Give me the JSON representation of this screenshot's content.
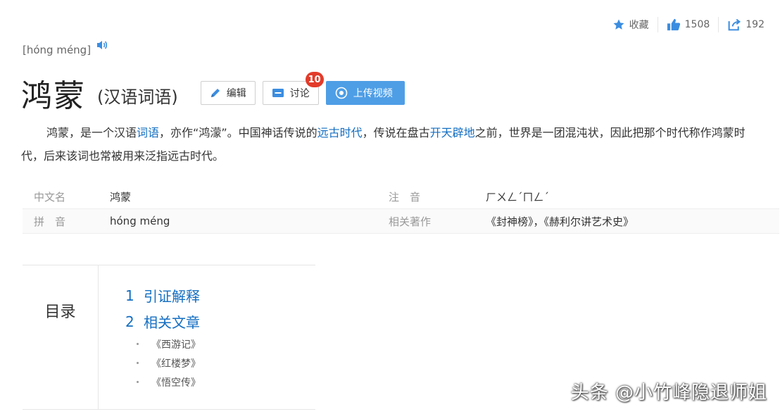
{
  "toolbar": {
    "favorite_label": "收藏",
    "like_count": "1508",
    "share_count": "192"
  },
  "pinyin": "[hóng méng]",
  "title": {
    "main": "鸿蒙",
    "sub": "(汉语词语)"
  },
  "buttons": {
    "edit_label": "编辑",
    "discuss_label": "讨论",
    "discuss_badge": "10",
    "upload_label": "上传视频"
  },
  "summary": {
    "p1": "鸿蒙，是一个汉语",
    "link1": "词语",
    "p2": "，亦作“鸿濛”。中国神话传说的",
    "link2": "远古时代",
    "p3": "，传说在盘古",
    "link3": "开天辟地",
    "p4": "之前，世界是一团混沌状，因此把那个时代称作鸿蒙时代，后来该词也常被用来泛指远古时代。"
  },
  "info": {
    "rows": [
      {
        "name1": "中文名",
        "value1": "鸿蒙",
        "name2": "注　音",
        "value2": "ㄏㄨㄥˊㄇㄥˊ"
      },
      {
        "name1": "拼　音",
        "value1": "hóng méng",
        "name2": "相关著作",
        "value2": "《封神榜》，《赫利尔讲艺术史》"
      }
    ]
  },
  "catalog": {
    "heading": "目录",
    "items": [
      {
        "num": "1",
        "label": "引证解释"
      },
      {
        "num": "2",
        "label": "相关文章"
      }
    ],
    "subitems": [
      "《西游记》",
      "《红楼梦》",
      "《悟空传》"
    ]
  },
  "watermark": "头条 @小竹峰隐退师姐",
  "colors": {
    "link": "#136ec2",
    "primary_button": "#4e9ee6",
    "badge": "#e33b2a"
  }
}
